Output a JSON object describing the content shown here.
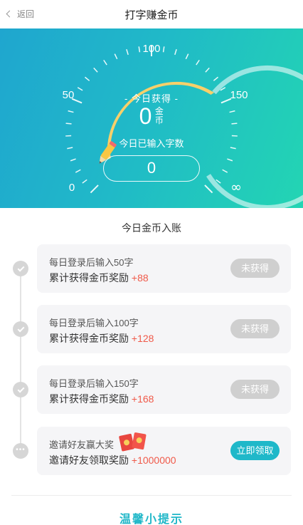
{
  "header": {
    "back_label": "返回",
    "title": "打字赚金币"
  },
  "gauge": {
    "tick_labels": [
      "0",
      "50",
      "100",
      "150",
      "∞"
    ],
    "earned_label": "- 今日获得 -",
    "coins_value": "0",
    "coins_unit": "金币",
    "typed_label": "今日已输入字数",
    "typed_value": "0"
  },
  "section_title": "今日金币入账",
  "rewards": [
    {
      "title": "每日登录后输入50字",
      "desc": "累计获得金币奖励 ",
      "amount": "+88",
      "button": "未获得"
    },
    {
      "title": "每日登录后输入100字",
      "desc": "累计获得金币奖励 ",
      "amount": "+128",
      "button": "未获得"
    },
    {
      "title": "每日登录后输入150字",
      "desc": "累计获得金币奖励 ",
      "amount": "+168",
      "button": "未获得"
    },
    {
      "title": "邀请好友赢大奖",
      "desc": "邀请好友领取奖励 ",
      "amount": "+1000000",
      "button": "立即领取"
    }
  ],
  "tips_title": "温馨小提示",
  "colors": {
    "accent": "#1fb8c9",
    "reward_red": "#f05a4a",
    "banner_start": "#1fa6cf",
    "banner_end": "#23d5b3"
  }
}
